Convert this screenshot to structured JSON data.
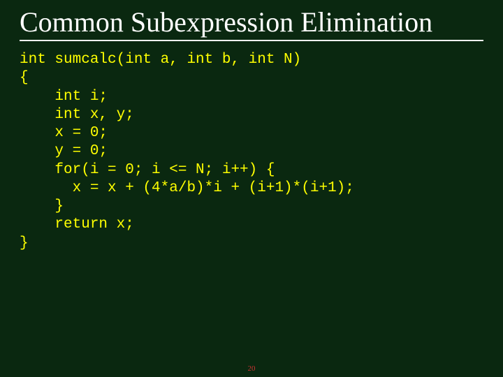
{
  "title": "Common Subexpression Elimination",
  "code": {
    "l1": "int sumcalc(int a, int b, int N)",
    "l2": "{",
    "l3": "    int i;",
    "l4": "    int x, y;",
    "l5": "    x = 0;",
    "l6": "    y = 0;",
    "l7": "    for(i = 0; i <= N; i++) {",
    "l8": "      x = x + (4*a/b)*i + (i+1)*(i+1);",
    "l9": "",
    "l10": "    }",
    "l11": "    return x;",
    "l12": "}"
  },
  "page_number": "20"
}
